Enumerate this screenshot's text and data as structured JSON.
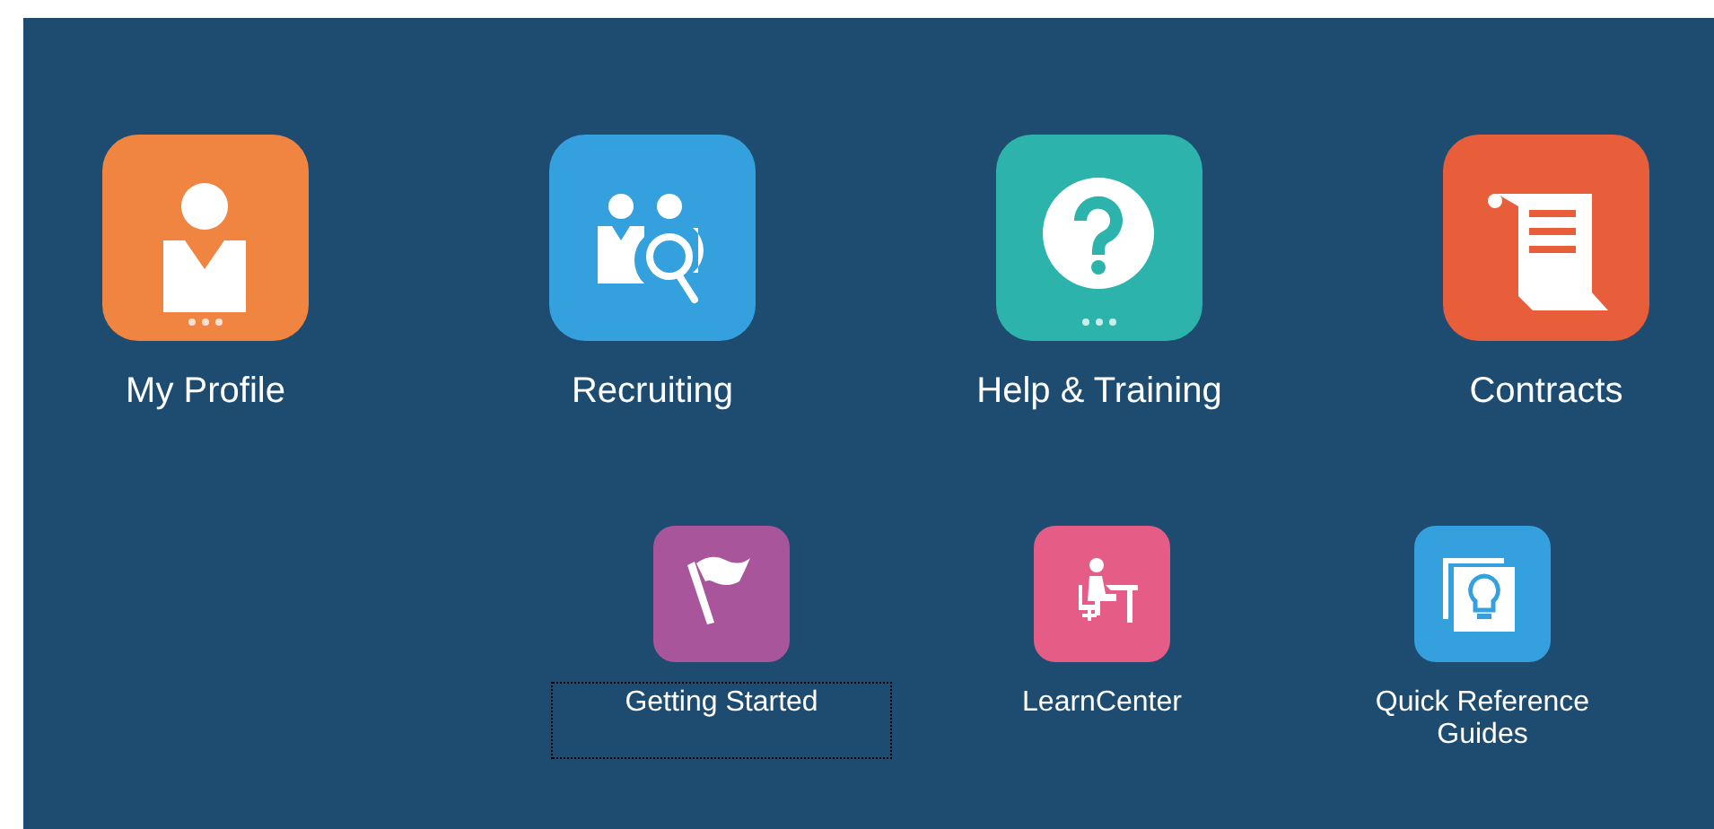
{
  "main_tiles": [
    {
      "label": "My Profile",
      "kind": "person",
      "color": "#ef8540",
      "more": true
    },
    {
      "label": "Recruiting",
      "kind": "recruit",
      "color": "#35a0de",
      "more": false
    },
    {
      "label": "Help & Training",
      "kind": "help",
      "color": "#2cb3ac",
      "more": true
    },
    {
      "label": "Contracts",
      "kind": "scroll",
      "color": "#e85d3a",
      "more": false
    }
  ],
  "small_tiles": [
    {
      "label": "Getting Started",
      "kind": "flag",
      "color": "#a8559c",
      "focused": true
    },
    {
      "label": "LearnCenter",
      "kind": "desk",
      "color": "#e55d86",
      "focused": false
    },
    {
      "label": "Quick Reference Guides",
      "kind": "bulb",
      "color": "#35a0de",
      "focused": false
    }
  ]
}
